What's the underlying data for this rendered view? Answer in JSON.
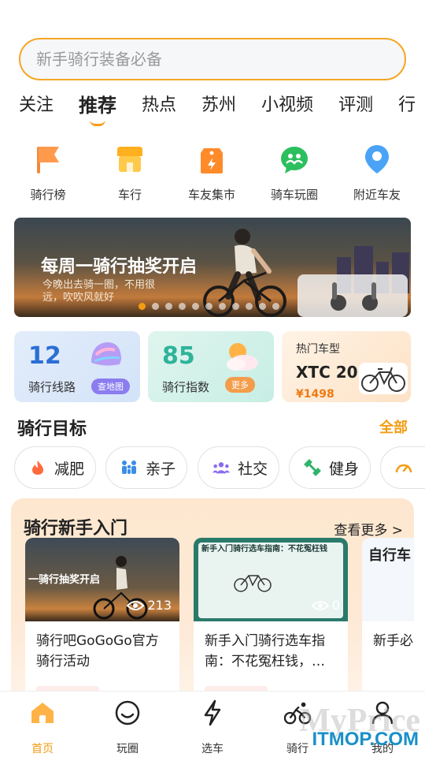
{
  "search": {
    "placeholder": "新手骑行装备必备"
  },
  "tabs": [
    "关注",
    "推荐",
    "热点",
    "苏州",
    "小视频",
    "评测",
    "行"
  ],
  "active_tab": "推荐",
  "quick_links": [
    {
      "label": "骑行榜",
      "icon": "flag-icon"
    },
    {
      "label": "车行",
      "icon": "shop-icon"
    },
    {
      "label": "车友集市",
      "icon": "price-tag-icon"
    },
    {
      "label": "骑车玩圈",
      "icon": "group-chat-icon"
    },
    {
      "label": "附近车友",
      "icon": "location-pin-icon"
    }
  ],
  "banner": {
    "title": "每周一骑行抽奖开启",
    "subtitle": "今晚出去骑一圈，不用很远，吹吹风就好",
    "slide_count": 11,
    "active_slide": 1
  },
  "cards": {
    "routes": {
      "number": "12",
      "label": "骑行线路",
      "button": "查地图"
    },
    "index": {
      "number": "85",
      "label": "骑行指数",
      "button": "更多"
    },
    "hot": {
      "title": "热门车型",
      "model": "XTC 20",
      "price": "¥1498"
    }
  },
  "goals": {
    "title": "骑行目标",
    "more": "全部",
    "items": [
      {
        "label": "减肥",
        "icon": "flame-icon",
        "color": "#ff6a3d"
      },
      {
        "label": "亲子",
        "icon": "family-icon",
        "color": "#3a8ee6"
      },
      {
        "label": "社交",
        "icon": "people-icon",
        "color": "#8b6cf0"
      },
      {
        "label": "健身",
        "icon": "dumbbell-icon",
        "color": "#2fb36a"
      },
      {
        "label": "",
        "icon": "speed-icon",
        "color": "#f39c12"
      }
    ]
  },
  "newbie": {
    "title_plain": "骑行新手",
    "title_highlight": "入门",
    "more": "查看更多 >",
    "articles": [
      {
        "title": "骑行吧GoGoGo官方骑行活动",
        "views": "213",
        "thumb_text": "一骑行抽奖开启"
      },
      {
        "title": "新手入门骑行选车指南：不花冤枉钱，…",
        "views": "0",
        "thumb_text": "新手入门骑行选车指南：不花冤枉钱"
      },
      {
        "title": "新手必动基础",
        "views": "",
        "thumb_text": "自行车"
      }
    ]
  },
  "bottom_nav": [
    {
      "label": "首页",
      "icon": "home-icon",
      "active": true
    },
    {
      "label": "玩圈",
      "icon": "smile-icon",
      "active": false
    },
    {
      "label": "选车",
      "icon": "lightning-icon",
      "active": false
    },
    {
      "label": "骑行",
      "icon": "bicycle-icon",
      "active": false
    },
    {
      "label": "我的",
      "icon": "user-icon",
      "active": false
    }
  ],
  "watermark": {
    "line1": "MyPrice",
    "line2": "ITMOP.COM"
  },
  "colors": {
    "accent": "#f39c12",
    "search_border": "#f5a623"
  }
}
